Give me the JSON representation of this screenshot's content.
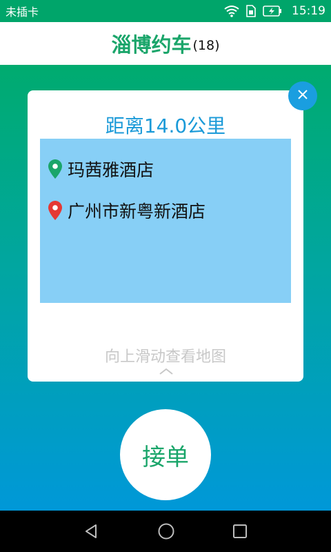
{
  "status_bar": {
    "carrier": "未插卡",
    "time": "15:19",
    "icons": [
      "wifi-icon",
      "sim-icon",
      "battery-charging-icon"
    ]
  },
  "header": {
    "title": "淄博约车",
    "count": "(18)"
  },
  "order_card": {
    "distance": "距离14.0公里",
    "from": "玛茜雅酒店",
    "to": "广州市新粤新酒店",
    "swipe_hint": "向上滑动查看地图"
  },
  "actions": {
    "accept_label": "接单"
  },
  "colors": {
    "brand_green": "#1aa56a",
    "accent_blue": "#1b9ad8",
    "route_bg": "#87cff6",
    "from_pin": "#1aa56a",
    "to_pin": "#e53935"
  },
  "nav": {
    "icons": [
      "back-icon",
      "home-icon",
      "recents-icon"
    ]
  }
}
